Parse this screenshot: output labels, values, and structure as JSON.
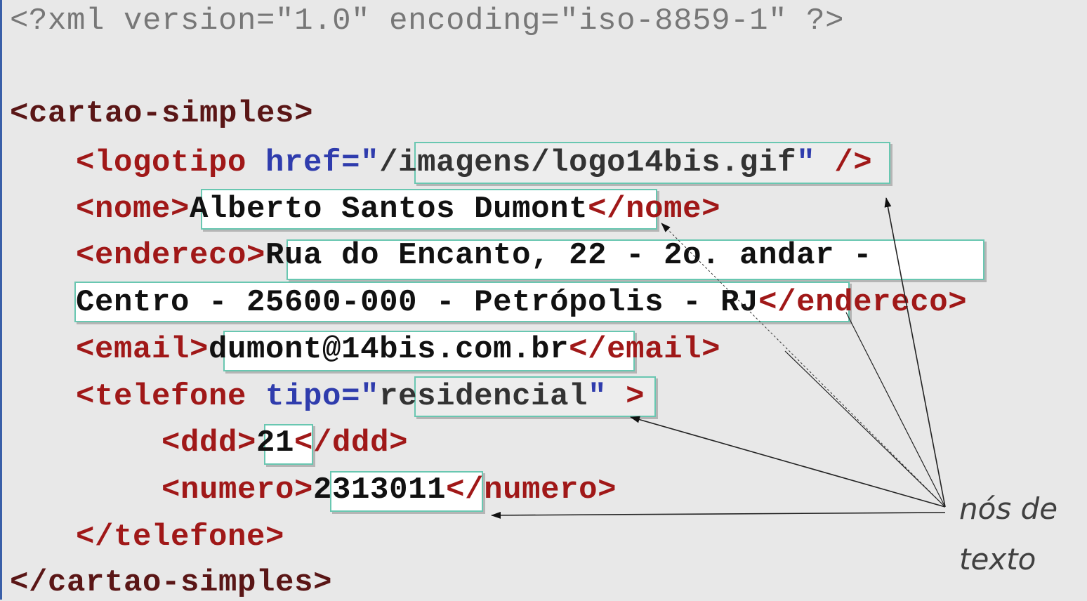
{
  "decl": "<?xml version=\"1.0\" encoding=\"iso-8859-1\" ?>",
  "root_open": "<cartao-simples>",
  "logo": {
    "open": "<logotipo ",
    "attr": "href=\"",
    "value": "/imagens/logo14bis.gif",
    "quote": "\"",
    "close": " />"
  },
  "nome": {
    "open": "<nome>",
    "text": "Alberto Santos Dumont",
    "close": "</nome>"
  },
  "endereco": {
    "open": "<endereco>",
    "text1": "Rua do Encanto, 22 - 2o. andar -",
    "text2": "Centro - 25600-000 - Petrópolis - RJ",
    "close": "</endereco>"
  },
  "email": {
    "open": "<email>",
    "text": "dumont@14bis.com.br",
    "close": "</email>"
  },
  "telefone": {
    "open": "<telefone ",
    "attr": "tipo=\"",
    "value": "residencial",
    "quote": "\"",
    "close": " >",
    "end": "</telefone>"
  },
  "ddd": {
    "open": "<ddd>",
    "text": "21",
    "close": "</ddd>"
  },
  "numero": {
    "open": "<numero>",
    "text": "2313011",
    "close": "</numero>"
  },
  "root_close": "</cartao-simples>",
  "caption": {
    "line1": "nós de",
    "line2": "texto"
  }
}
